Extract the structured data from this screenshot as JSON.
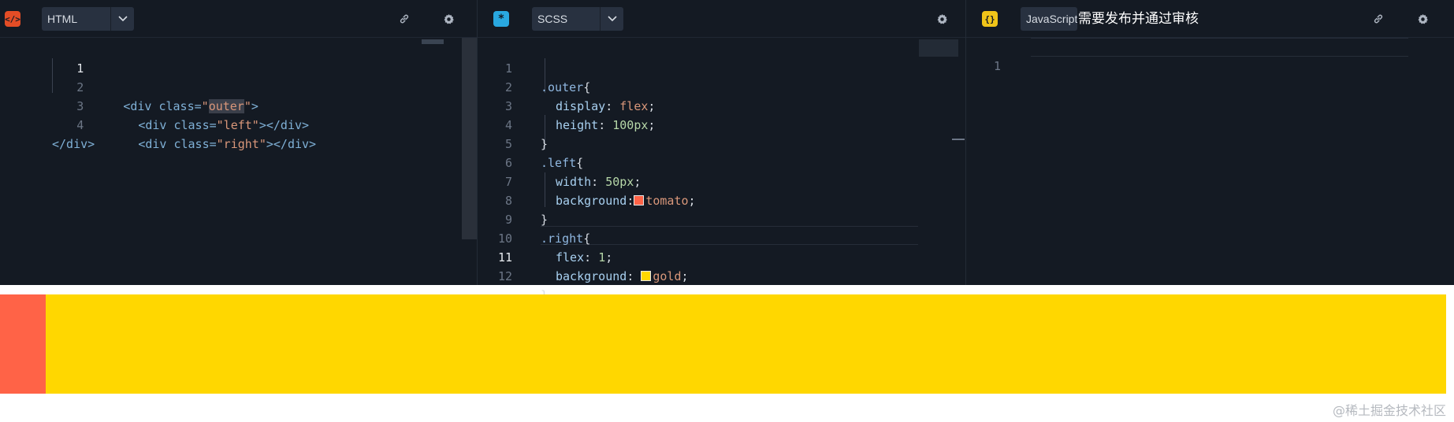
{
  "html_pane": {
    "language": "HTML",
    "icon": "html-icon",
    "lines": [
      {
        "n": "1",
        "active": true
      },
      {
        "n": "2"
      },
      {
        "n": "3"
      },
      {
        "n": "4"
      }
    ],
    "code": {
      "l1_open": "<div class=",
      "l1_q1": "\"",
      "l1_value": "outer",
      "l1_q2": "\"",
      "l1_close": ">",
      "l2_open": "<div class=",
      "l2_value": "\"left\"",
      "l2_close": "></div>",
      "l3_open": "<div class=",
      "l3_value": "\"right\"",
      "l3_close": "></div>",
      "l4": "</div>"
    }
  },
  "css_pane": {
    "language": "SCSS",
    "icon": "scss-icon",
    "lines": [
      "1",
      "2",
      "3",
      "4",
      "5",
      "6",
      "7",
      "8",
      "9",
      "10",
      "11",
      "12"
    ],
    "active_line": "11",
    "code": {
      "l1_sel": ".outer",
      "l1_brace": "{",
      "l2_prop": "display",
      "l2_val": "flex",
      "l3_prop": "height",
      "l3_val": "100px",
      "l4": "}",
      "l5_sel": ".left",
      "l5_brace": "{",
      "l6_prop": "width",
      "l6_val": "50px",
      "l7_prop": "background",
      "l7_val": "tomato",
      "l8": "}",
      "l9_sel": ".right",
      "l9_brace": "{",
      "l10_prop": "flex",
      "l10_val": "1",
      "l11_prop": "background",
      "l11_val": "gold",
      "l12": "}",
      "colon": ":",
      "semicolon": ";"
    },
    "swatches": {
      "tomato": "#ff6347",
      "gold": "#ffd700"
    }
  },
  "js_pane": {
    "language": "JavaScript",
    "icon": "js-icon",
    "lines": [
      "1"
    ],
    "tooltip": "需要发布并通过审核"
  },
  "preview": {
    "left_color": "#ff6347",
    "right_color": "#ffd700"
  },
  "watermark": "@稀土掘金技术社区",
  "colors": {
    "editor_bg": "#141a23",
    "toolbar_select": "#283140"
  }
}
